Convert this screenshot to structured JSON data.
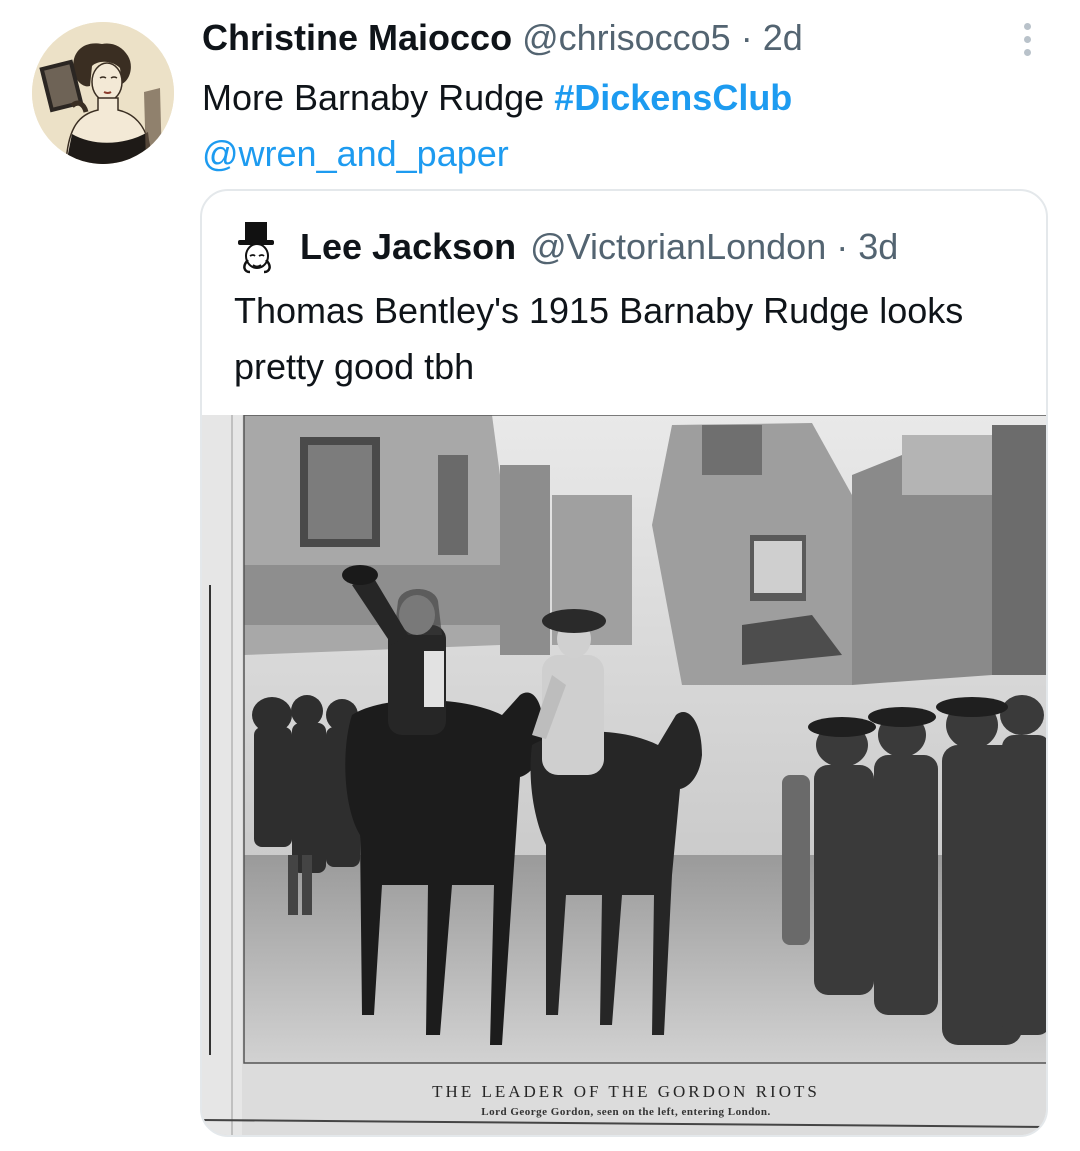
{
  "tweet": {
    "author_name": "Christine Maiocco",
    "handle": "@chrisocco5",
    "separator": "·",
    "time": "2d",
    "text": "More Barnaby Rudge",
    "hashtag": "#DickensClub",
    "mention": "@wren_and_paper",
    "avatar_icon": "vintage-woman-reading-illustration"
  },
  "quoted_tweet": {
    "author_name": "Lee Jackson",
    "handle": "@VictorianLondon",
    "separator": "·",
    "time": "3d",
    "text": "Thomas Bentley's 1915 Barnaby Rudge looks pretty good tbh",
    "avatar_icon": "top-hat-gentleman-icon",
    "media": {
      "caption_title": "THE LEADER OF THE GORDON RIOTS",
      "caption_subtitle": "Lord George Gordon, seen on the left, entering London."
    }
  },
  "colors": {
    "link": "#1d9bf0",
    "secondary_text": "#536471",
    "primary_text": "#0f1419",
    "card_border": "#e4e8eb"
  }
}
